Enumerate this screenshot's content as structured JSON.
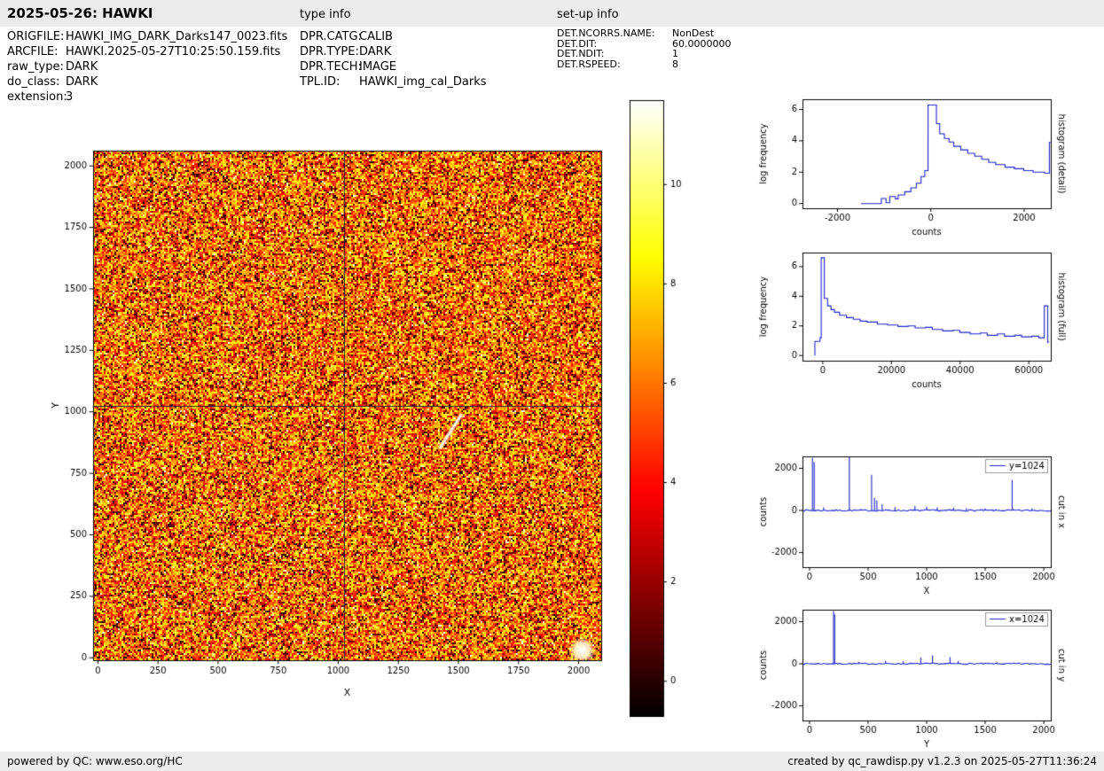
{
  "header": {
    "title": "2025-05-26: HAWKI",
    "type_info_heading": "type info",
    "setup_info_heading": "set-up info"
  },
  "metadata": {
    "file_info": [
      {
        "label": "ORIGFILE:",
        "value": "HAWKI_IMG_DARK_Darks147_0023.fits"
      },
      {
        "label": "ARCFILE:",
        "value": "HAWKI.2025-05-27T10:25:50.159.fits"
      },
      {
        "label": "raw_type:",
        "value": "DARK"
      },
      {
        "label": "do_class:",
        "value": "DARK"
      },
      {
        "label": "extension:",
        "value": "3"
      }
    ],
    "type_info": [
      {
        "label": "DPR.CATG:",
        "value": "CALIB"
      },
      {
        "label": "DPR.TYPE:",
        "value": "DARK"
      },
      {
        "label": "DPR.TECH:",
        "value": "IMAGE"
      },
      {
        "label": "TPL.ID:",
        "value": "HAWKI_img_cal_Darks"
      }
    ],
    "setup_info": [
      {
        "label": "DET.NCORRS.NAME:",
        "value": "NonDest"
      },
      {
        "label": "DET.DIT:",
        "value": "60.0000000"
      },
      {
        "label": "DET.NDIT:",
        "value": "1"
      },
      {
        "label": "DET.RSPEED:",
        "value": "8"
      }
    ]
  },
  "footer": {
    "left": "powered by QC: www.eso.org/HC",
    "right": "created by qc_rawdisp.py v1.2.3 on 2025-05-27T11:36:24"
  },
  "colors": {
    "line": "#2222cc",
    "frame": "#000000",
    "bar_background": "#ececec",
    "colormap": "hot"
  },
  "chart_data": [
    {
      "name": "raw-image",
      "type": "heatmap",
      "xlabel": "X",
      "ylabel": "Y",
      "xlim": [
        -20,
        2094
      ],
      "ylim": [
        -10,
        2062
      ],
      "xticks": [
        0,
        250,
        500,
        750,
        1000,
        1250,
        1500,
        1750,
        2000
      ],
      "yticks": [
        0,
        250,
        500,
        750,
        1000,
        1250,
        1500,
        1750,
        2000
      ],
      "cut_lines": {
        "x": 1024,
        "y": 1024
      },
      "features": {
        "bright_blob": [
          2015,
          30
        ],
        "streak": [
          [
            1425,
            855
          ],
          [
            1510,
            985
          ]
        ]
      },
      "colorbar": {
        "vmin": -0.7,
        "vmax": 11.7,
        "ticks": [
          0,
          2,
          4,
          6,
          8,
          10
        ],
        "colormap": "hot"
      }
    },
    {
      "name": "histogram-detail",
      "type": "line",
      "right_label": "histogram (detail)",
      "xlabel": "counts",
      "ylabel": "log frequency",
      "xlim": [
        -2750,
        2570
      ],
      "ylim": [
        -0.3,
        6.65
      ],
      "xticks": [
        -2000,
        0,
        2000
      ],
      "yticks": [
        0,
        2,
        4,
        6
      ],
      "points": [
        [
          -1500,
          0
        ],
        [
          -1060,
          0
        ],
        [
          -1060,
          0.32
        ],
        [
          -960,
          0.32
        ],
        [
          -960,
          0.05
        ],
        [
          -880,
          0.05
        ],
        [
          -880,
          0.45
        ],
        [
          -760,
          0.45
        ],
        [
          -760,
          0.3
        ],
        [
          -700,
          0.3
        ],
        [
          -700,
          0.55
        ],
        [
          -560,
          0.55
        ],
        [
          -560,
          0.75
        ],
        [
          -430,
          0.75
        ],
        [
          -430,
          1.0
        ],
        [
          -310,
          1.0
        ],
        [
          -310,
          1.3
        ],
        [
          -210,
          1.3
        ],
        [
          -210,
          1.72
        ],
        [
          -130,
          1.72
        ],
        [
          -130,
          2.1
        ],
        [
          -60,
          2.1
        ],
        [
          -60,
          6.28
        ],
        [
          120,
          6.28
        ],
        [
          120,
          5.1
        ],
        [
          190,
          5.1
        ],
        [
          190,
          4.45
        ],
        [
          290,
          4.45
        ],
        [
          290,
          4.15
        ],
        [
          390,
          4.15
        ],
        [
          390,
          3.92
        ],
        [
          490,
          3.92
        ],
        [
          490,
          3.65
        ],
        [
          640,
          3.65
        ],
        [
          640,
          3.42
        ],
        [
          790,
          3.42
        ],
        [
          790,
          3.2
        ],
        [
          940,
          3.2
        ],
        [
          940,
          3.02
        ],
        [
          1090,
          3.02
        ],
        [
          1090,
          2.82
        ],
        [
          1240,
          2.82
        ],
        [
          1240,
          2.62
        ],
        [
          1390,
          2.62
        ],
        [
          1390,
          2.48
        ],
        [
          1590,
          2.48
        ],
        [
          1590,
          2.32
        ],
        [
          1790,
          2.32
        ],
        [
          1790,
          2.22
        ],
        [
          1990,
          2.22
        ],
        [
          1990,
          2.1
        ],
        [
          2190,
          2.1
        ],
        [
          2190,
          2.0
        ],
        [
          2440,
          2.0
        ],
        [
          2440,
          1.93
        ],
        [
          2540,
          1.93
        ],
        [
          2540,
          3.9
        ],
        [
          2560,
          3.9
        ]
      ]
    },
    {
      "name": "histogram-full",
      "type": "line",
      "right_label": "histogram (full)",
      "xlabel": "counts",
      "ylabel": "log frequency",
      "xlim": [
        -5900,
        66400
      ],
      "ylim": [
        -0.35,
        6.95
      ],
      "xticks": [
        0,
        20000,
        40000,
        60000
      ],
      "yticks": [
        0,
        2,
        4,
        6
      ],
      "points": [
        [
          -2300,
          0
        ],
        [
          -2300,
          0.95
        ],
        [
          -800,
          0.95
        ],
        [
          -800,
          1.2
        ],
        [
          -450,
          1.2
        ],
        [
          -450,
          6.6
        ],
        [
          450,
          6.6
        ],
        [
          450,
          3.85
        ],
        [
          1400,
          3.85
        ],
        [
          1400,
          3.35
        ],
        [
          2400,
          3.35
        ],
        [
          2400,
          3.1
        ],
        [
          3400,
          3.1
        ],
        [
          3400,
          2.92
        ],
        [
          4900,
          2.92
        ],
        [
          4900,
          2.72
        ],
        [
          6900,
          2.72
        ],
        [
          6900,
          2.56
        ],
        [
          8900,
          2.56
        ],
        [
          8900,
          2.45
        ],
        [
          10900,
          2.45
        ],
        [
          10900,
          2.32
        ],
        [
          12900,
          2.32
        ],
        [
          12900,
          2.26
        ],
        [
          15900,
          2.26
        ],
        [
          15900,
          2.12
        ],
        [
          18900,
          2.12
        ],
        [
          18900,
          2.06
        ],
        [
          21900,
          2.06
        ],
        [
          21900,
          1.96
        ],
        [
          24900,
          1.96
        ],
        [
          24900,
          2.0
        ],
        [
          26900,
          2.0
        ],
        [
          26900,
          1.86
        ],
        [
          29900,
          1.86
        ],
        [
          29900,
          1.9
        ],
        [
          31900,
          1.9
        ],
        [
          31900,
          1.76
        ],
        [
          34900,
          1.76
        ],
        [
          34900,
          1.66
        ],
        [
          37900,
          1.66
        ],
        [
          37900,
          1.7
        ],
        [
          39900,
          1.7
        ],
        [
          39900,
          1.56
        ],
        [
          42900,
          1.56
        ],
        [
          42900,
          1.46
        ],
        [
          45900,
          1.46
        ],
        [
          45900,
          1.52
        ],
        [
          47900,
          1.52
        ],
        [
          47900,
          1.36
        ],
        [
          50900,
          1.36
        ],
        [
          50900,
          1.46
        ],
        [
          52900,
          1.46
        ],
        [
          52900,
          1.3
        ],
        [
          55900,
          1.3
        ],
        [
          55900,
          1.36
        ],
        [
          57900,
          1.36
        ],
        [
          57900,
          1.26
        ],
        [
          60900,
          1.26
        ],
        [
          60900,
          1.3
        ],
        [
          62900,
          1.3
        ],
        [
          62900,
          1.2
        ],
        [
          64500,
          1.2
        ],
        [
          64500,
          3.35
        ],
        [
          65500,
          3.35
        ],
        [
          65500,
          0.9
        ],
        [
          65900,
          0.9
        ]
      ]
    },
    {
      "name": "cut-in-x",
      "type": "spikes",
      "right_label": "cut in x",
      "xlabel": "X",
      "ylabel": "counts",
      "legend": "y=1024",
      "xlim": [
        -60,
        2060
      ],
      "ylim": [
        -2700,
        2570
      ],
      "xticks": [
        0,
        500,
        1000,
        1500,
        2000
      ],
      "yticks": [
        -2000,
        0,
        2000
      ],
      "noise": 35,
      "spikes": [
        [
          25,
          2500
        ],
        [
          40,
          2300
        ],
        [
          120,
          150
        ],
        [
          340,
          2550
        ],
        [
          530,
          1700
        ],
        [
          555,
          600
        ],
        [
          575,
          480
        ],
        [
          620,
          300
        ],
        [
          730,
          160
        ],
        [
          900,
          210
        ],
        [
          1000,
          180
        ],
        [
          1090,
          150
        ],
        [
          1230,
          130
        ],
        [
          1340,
          110
        ],
        [
          1500,
          90
        ],
        [
          1730,
          1450
        ],
        [
          1900,
          90
        ]
      ]
    },
    {
      "name": "cut-in-y",
      "type": "spikes",
      "right_label": "cut in y",
      "xlabel": "Y",
      "ylabel": "counts",
      "legend": "x=1024",
      "xlim": [
        -60,
        2060
      ],
      "ylim": [
        -2700,
        2570
      ],
      "xticks": [
        0,
        500,
        1000,
        1500,
        2000
      ],
      "yticks": [
        -2000,
        0,
        2000
      ],
      "noise": 30,
      "spikes": [
        [
          205,
          2500
        ],
        [
          215,
          2350
        ],
        [
          420,
          90
        ],
        [
          650,
          130
        ],
        [
          800,
          110
        ],
        [
          950,
          290
        ],
        [
          1050,
          400
        ],
        [
          1200,
          310
        ],
        [
          1270,
          130
        ],
        [
          1600,
          80
        ]
      ]
    }
  ]
}
